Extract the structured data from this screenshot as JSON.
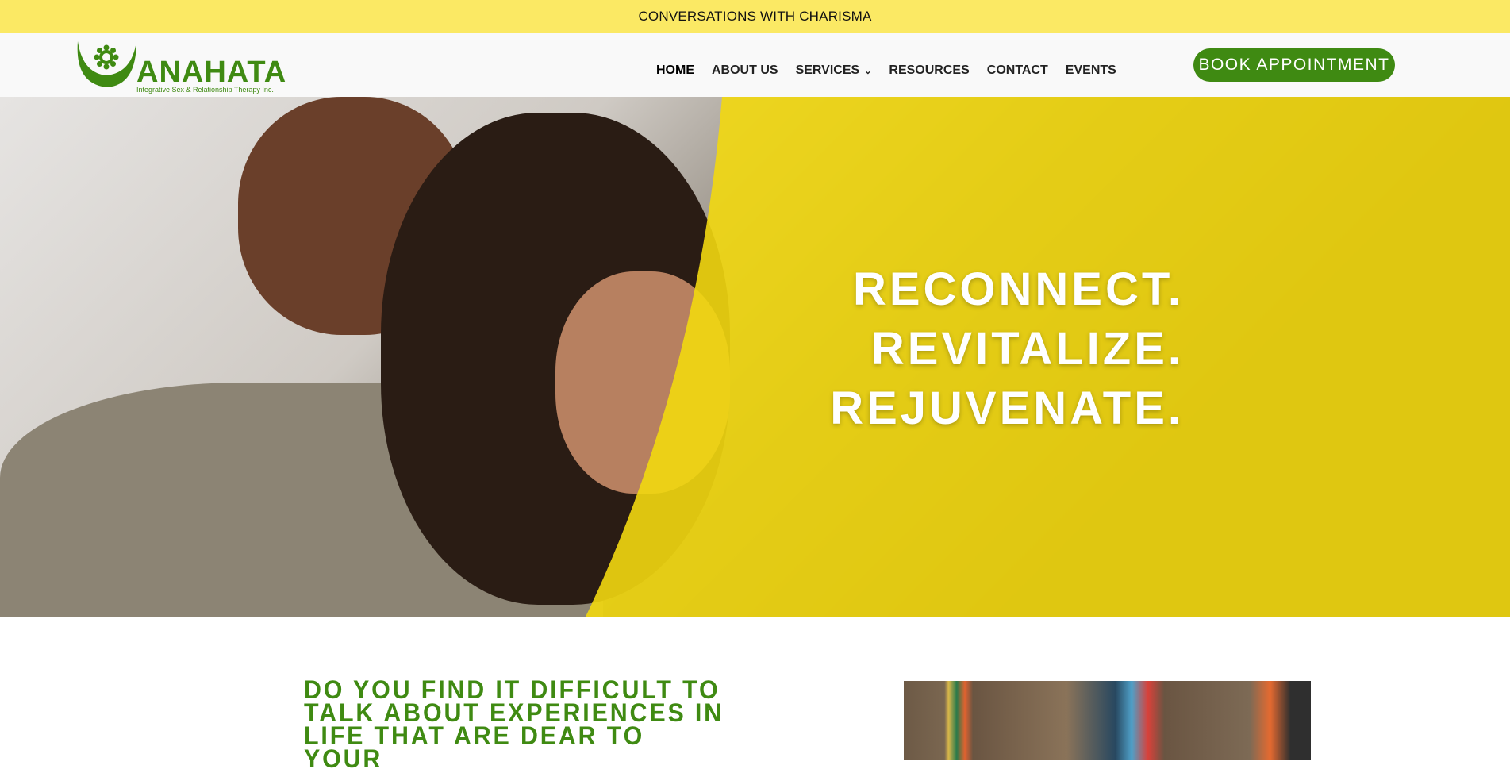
{
  "topbar": {
    "text": "CONVERSATIONS WITH CHARISMA"
  },
  "logo": {
    "word": "ANAHATA",
    "tagline": "Integrative Sex & Relationship Therapy Inc."
  },
  "nav": {
    "items": [
      "HOME",
      "ABOUT US",
      "SERVICES",
      "RESOURCES",
      "CONTACT",
      "EVENTS"
    ],
    "cta": "BOOK APPOINTMENT"
  },
  "hero": {
    "lines": [
      "RECONNECT.",
      "REVITALIZE.",
      "REJUVENATE."
    ]
  },
  "intro": {
    "heading": "DO YOU FIND IT DIFFICULT TO TALK ABOUT EXPERIENCES IN LIFE THAT ARE DEAR TO YOUR"
  },
  "colors": {
    "brand_green": "#3f8a12",
    "topbar_yellow": "#fbe964",
    "overlay_yellow": "#f2d80f"
  }
}
